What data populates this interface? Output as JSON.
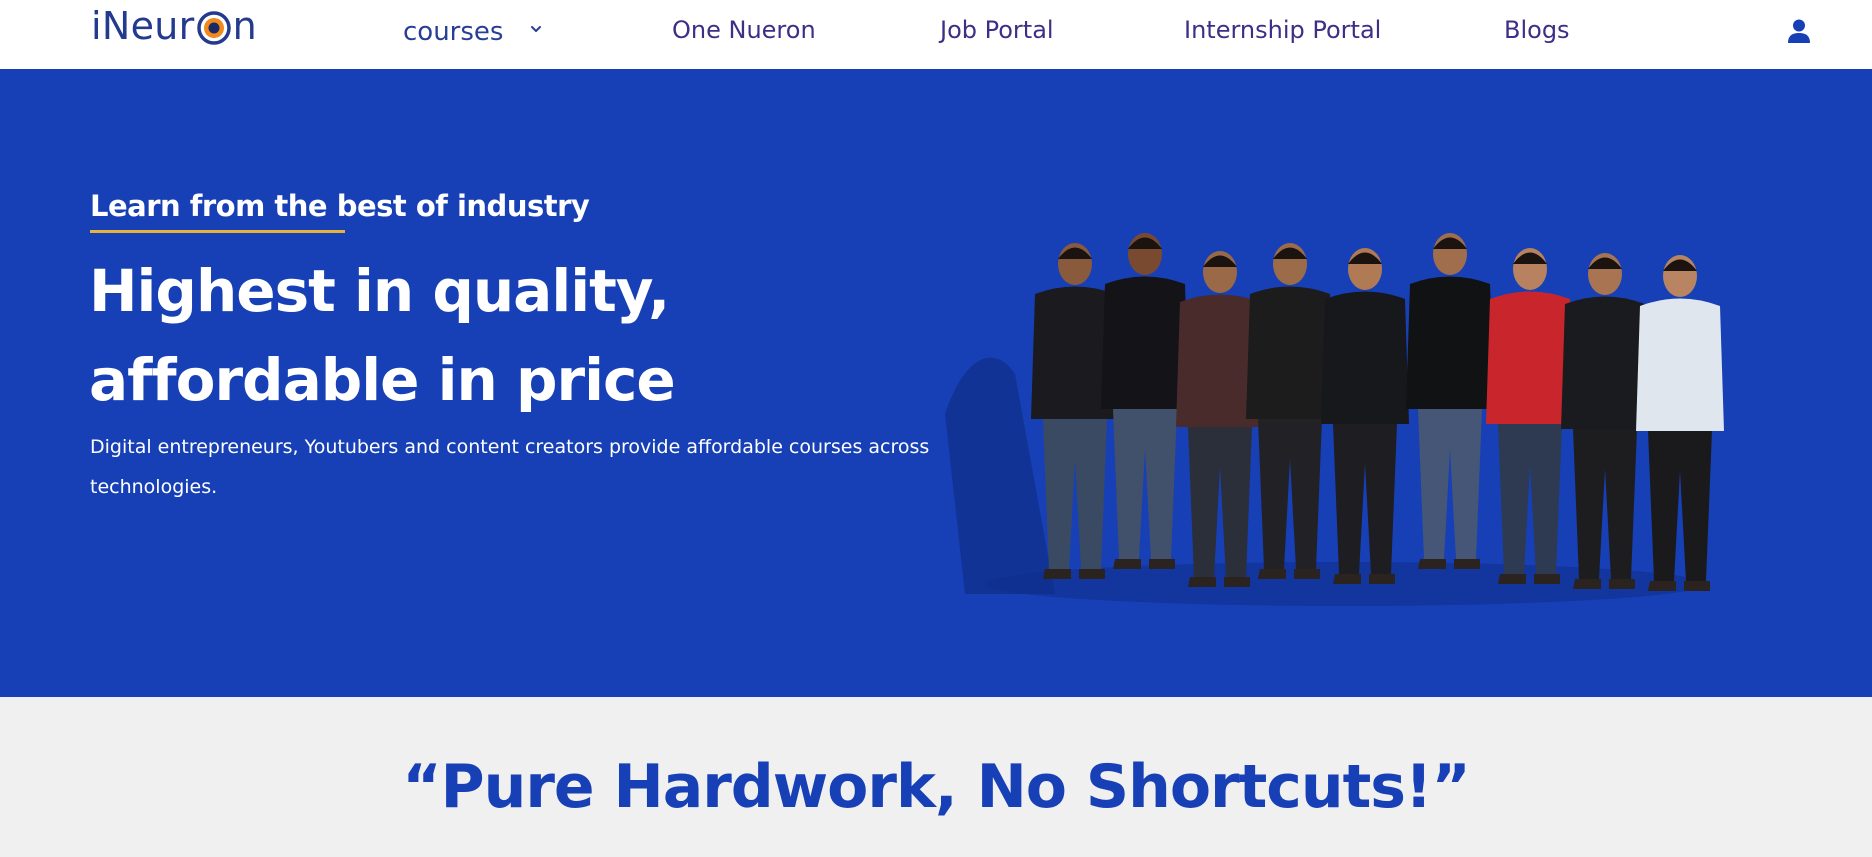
{
  "nav": {
    "logo_text_left": "iNeur",
    "logo_text_right": "n",
    "courses_label": "courses",
    "links": [
      "One Nueron",
      "Job Portal",
      "Internship Portal",
      "Blogs"
    ],
    "icons": {
      "courses_dropdown": "chevron-down-icon",
      "account": "user-icon"
    }
  },
  "hero": {
    "kicker": "Learn from the best of industry",
    "title_line1": "Highest in quality,",
    "title_line2": "affordable in price",
    "description": "Digital entrepreneurs, Youtubers and content creators provide affordable courses across technologies.",
    "image_alt": "iNeuron team"
  },
  "quote": {
    "text": "“Pure Hardwork, No Shortcuts!”"
  },
  "colors": {
    "brand_blue": "#1740b6",
    "nav_text": "#3d2f86",
    "accent_gold": "#e8b33a",
    "quote_bg": "#f0f0f0"
  }
}
